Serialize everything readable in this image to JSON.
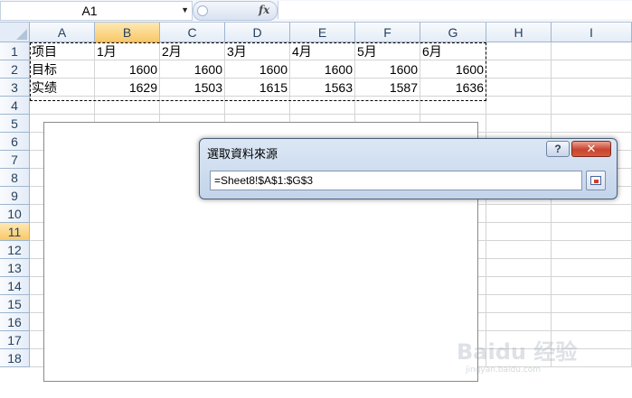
{
  "formula_bar": {
    "name_box": "A1",
    "fx_label": "fx",
    "formula": ""
  },
  "columns": [
    "A",
    "B",
    "C",
    "D",
    "E",
    "F",
    "G",
    "H",
    "I"
  ],
  "selected_column": "B",
  "rows": [
    "1",
    "2",
    "3",
    "4",
    "5",
    "6",
    "7",
    "8",
    "9",
    "10",
    "11",
    "12",
    "13",
    "14",
    "15",
    "16",
    "17",
    "18"
  ],
  "selected_row": "11",
  "cells": {
    "r1": [
      "项目",
      "1月",
      "2月",
      "3月",
      "4月",
      "5月",
      "6月"
    ],
    "r2": [
      "目标",
      "1600",
      "1600",
      "1600",
      "1600",
      "1600",
      "1600"
    ],
    "r3": [
      "实绩",
      "1629",
      "1503",
      "1615",
      "1563",
      "1587",
      "1636"
    ]
  },
  "dialog": {
    "title": "選取資料來源",
    "help": "?",
    "close": "✕",
    "range_value": "=Sheet8!$A$1:$G$3"
  },
  "watermark": {
    "text": "Baidu 经验",
    "sub": "jingyan.baidu.com"
  }
}
